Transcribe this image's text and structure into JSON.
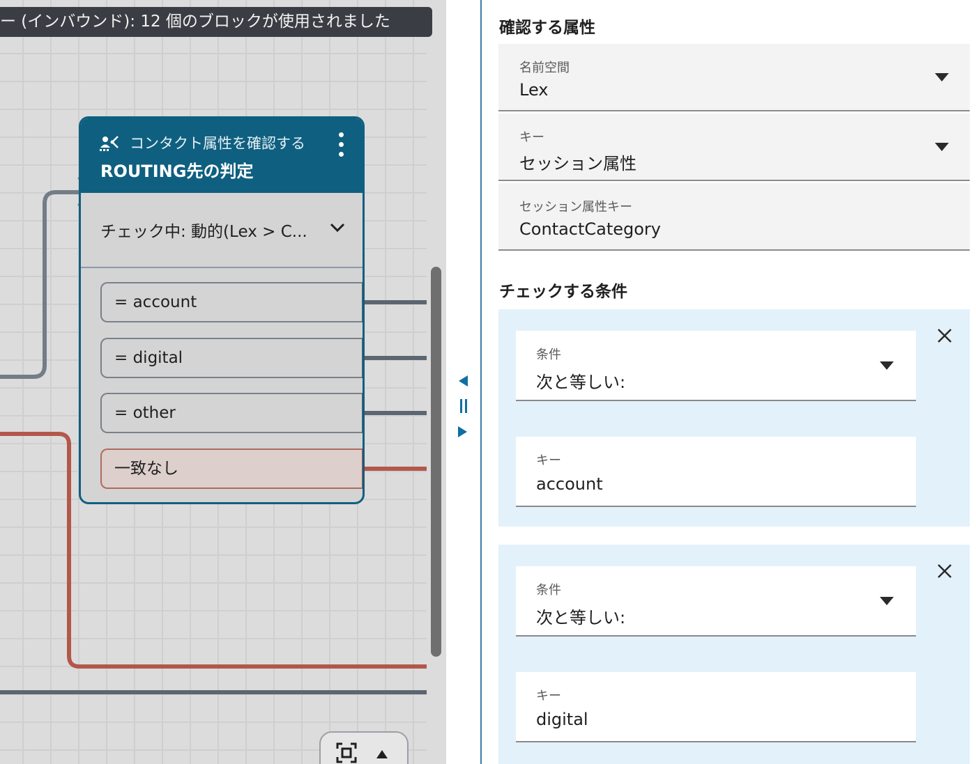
{
  "canvas": {
    "usage_banner": "ー (インバウンド): 12 個のブロックが使用されました",
    "block": {
      "type_label": "コンタクト属性を確認する",
      "title": "ROUTING先の判定",
      "checking": "チェック中: 動的(Lex > C...",
      "branches": [
        {
          "label": "= account"
        },
        {
          "label": "= digital"
        },
        {
          "label": "= other"
        },
        {
          "label": "一致なし"
        }
      ]
    },
    "colors": {
      "block_header": "#0f5f80",
      "branch_connector": "#5c6670",
      "nomatch_connector": "#b3574a"
    }
  },
  "panel": {
    "attributes_title": "確認する属性",
    "namespace": {
      "label": "名前空間",
      "value": "Lex"
    },
    "key": {
      "label": "キー",
      "value": "セッション属性"
    },
    "session_key": {
      "label": "セッション属性キー",
      "value": "ContactCategory"
    },
    "conditions_title": "チェックする条件",
    "conditions": [
      {
        "condition_label": "条件",
        "condition_value": "次と等しい:",
        "key_label": "キー",
        "key_value": "account"
      },
      {
        "condition_label": "条件",
        "condition_value": "次と等しい:",
        "key_label": "キー",
        "key_value": "digital"
      }
    ],
    "colors": {
      "condition_card_bg": "#e3f1fb",
      "splitter": "#3a7ca5"
    }
  }
}
